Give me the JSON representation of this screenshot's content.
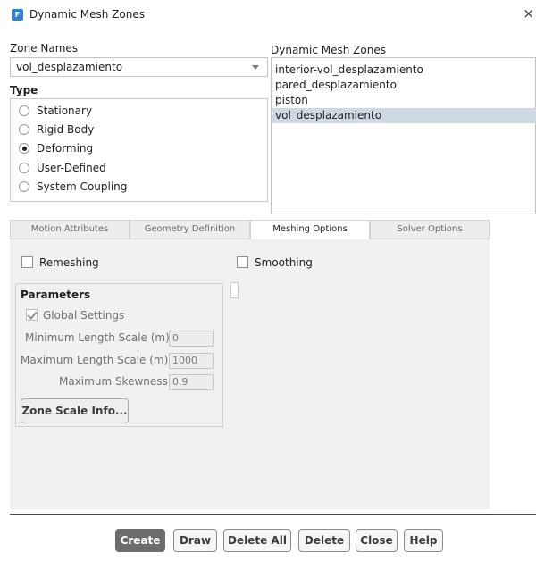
{
  "window": {
    "title": "Dynamic Mesh Zones",
    "close_glyph": "×",
    "app_icon": "fluent-app-icon",
    "app_icon_letter": "F"
  },
  "zone_names": {
    "label": "Zone Names",
    "selected": "vol_desplazamiento"
  },
  "type": {
    "label": "Type",
    "options": [
      {
        "label": "Stationary",
        "selected": false
      },
      {
        "label": "Rigid Body",
        "selected": false
      },
      {
        "label": "Deforming",
        "selected": true
      },
      {
        "label": "User-Defined",
        "selected": false
      },
      {
        "label": "System Coupling",
        "selected": false
      }
    ]
  },
  "dynamic_mesh_zones": {
    "label": "Dynamic Mesh Zones",
    "items": [
      {
        "label": "interior-vol_desplazamiento",
        "selected": false
      },
      {
        "label": "pared_desplazamiento",
        "selected": false
      },
      {
        "label": "piston",
        "selected": false
      },
      {
        "label": "vol_desplazamiento",
        "selected": true
      }
    ]
  },
  "tabs": [
    {
      "label": "Motion Attributes",
      "active": false
    },
    {
      "label": "Geometry Definition",
      "active": false
    },
    {
      "label": "Meshing Options",
      "active": true
    },
    {
      "label": "Solver Options",
      "active": false
    }
  ],
  "meshing": {
    "remeshing_label": "Remeshing",
    "remeshing_checked": false,
    "smoothing_label": "Smoothing",
    "smoothing_checked": false
  },
  "parameters": {
    "title": "Parameters",
    "global_settings_label": "Global Settings",
    "global_settings_checked": true,
    "min_length_label": "Minimum Length Scale (m)",
    "min_length_value": "0",
    "max_length_label": "Maximum Length Scale (m)",
    "max_length_value": "1000",
    "max_skewness_label": "Maximum Skewness",
    "max_skewness_value": "0.9",
    "zone_scale_info_label": "Zone Scale Info..."
  },
  "buttons": {
    "create": "Create",
    "draw": "Draw",
    "delete_all": "Delete All",
    "delete": "Delete",
    "close": "Close",
    "help": "Help"
  },
  "colors": {
    "selection": "#cfd9e3",
    "primary_button": "#6d6d6d",
    "app_icon": "#2f7fd6"
  }
}
